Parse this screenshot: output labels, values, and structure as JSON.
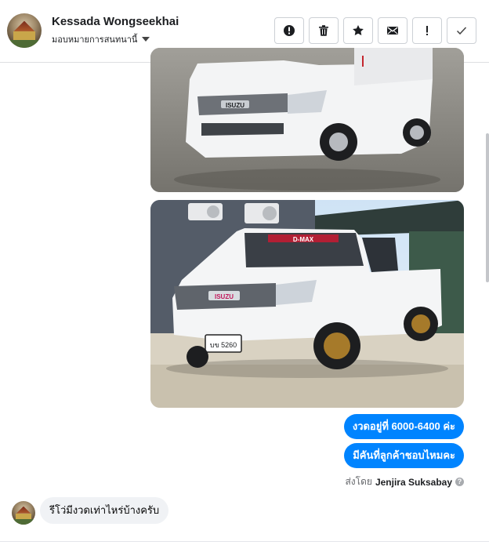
{
  "header": {
    "contact_name": "Kessada Wongseekhai",
    "assign_label": "มอบหมายการสนทนานี้",
    "tools": [
      {
        "icon": "alert-circle-icon",
        "label": "Report"
      },
      {
        "icon": "trash-icon",
        "label": "Delete"
      },
      {
        "icon": "star-icon",
        "label": "Star"
      },
      {
        "icon": "mail-icon",
        "label": "Mark as unread"
      },
      {
        "icon": "exclamation-icon",
        "label": "Spam"
      },
      {
        "icon": "check-icon",
        "label": "Done"
      }
    ]
  },
  "messages": {
    "outgoing": [
      {
        "text": "งวดอยู่ที่ 6000-6400 ค่ะ"
      },
      {
        "text": "มีคันที่ลูกค้าชอบไหมคะ"
      }
    ],
    "sent_by_prefix": "ส่งโดย",
    "sent_by_name": "Jenjira Suksabay",
    "help_glyph": "?",
    "incoming": [
      {
        "text": "รีโว่มีงวดเท่าไหร่บ้างครับ"
      }
    ]
  },
  "photos": [
    {
      "plate_text": "ISUZU"
    },
    {
      "plate_text": "ISUZU",
      "license_text": "บข 5260",
      "windshield_text": "D-MAX"
    }
  ],
  "colors": {
    "accent": "#0084ff",
    "incoming_bubble": "#f0f2f5",
    "border": "#ccd0d5"
  }
}
